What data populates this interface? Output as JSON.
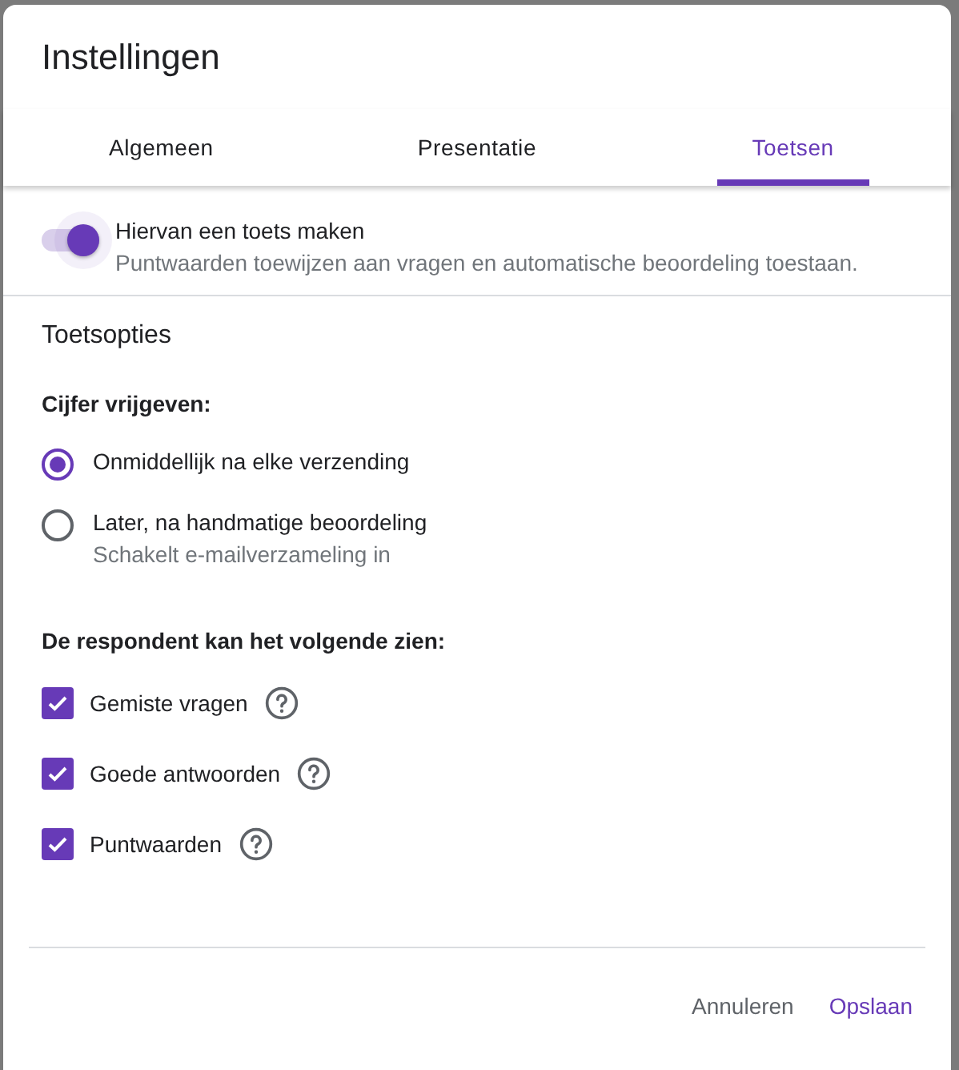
{
  "dialog": {
    "title": "Instellingen",
    "tabs": [
      {
        "label": "Algemeen",
        "selected": false
      },
      {
        "label": "Presentatie",
        "selected": false
      },
      {
        "label": "Toetsen",
        "selected": true
      }
    ],
    "quiz_toggle": {
      "label": "Hiervan een toets maken",
      "description": "Puntwaarden toewijzen aan vragen en automatische beoordeling toestaan.",
      "on": true
    },
    "section_title": "Toetsopties",
    "release_grade": {
      "heading": "Cijfer vrijgeven:",
      "options": [
        {
          "label": "Onmiddellijk na elke verzending",
          "selected": true
        },
        {
          "label": "Later, na handmatige beoordeling",
          "hint": "Schakelt e-mailverzameling in",
          "selected": false
        }
      ]
    },
    "respondent_can_see": {
      "heading": "De respondent kan het volgende zien:",
      "options": [
        {
          "label": "Gemiste vragen",
          "checked": true
        },
        {
          "label": "Goede antwoorden",
          "checked": true
        },
        {
          "label": "Puntwaarden",
          "checked": true
        }
      ]
    },
    "buttons": [
      {
        "label": "Annuleren"
      },
      {
        "label": "Opslaan"
      }
    ]
  }
}
